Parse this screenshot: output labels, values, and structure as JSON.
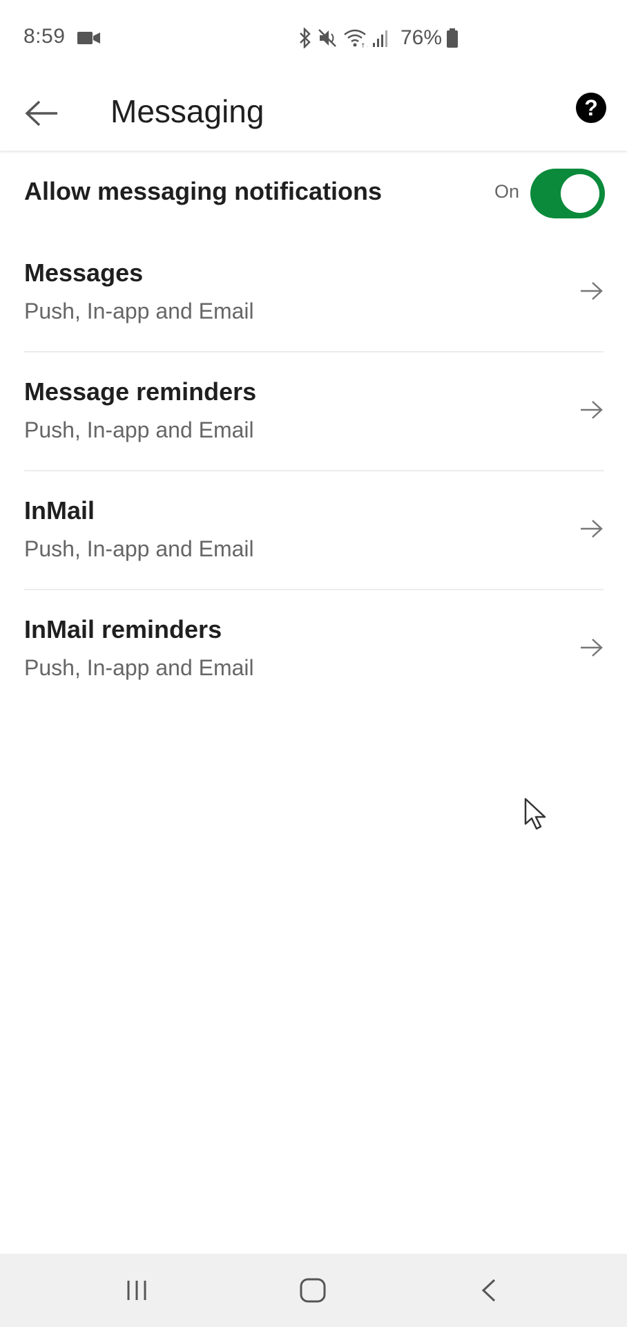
{
  "status_bar": {
    "time": "8:59",
    "battery": "76%",
    "icons": [
      "video-record-icon",
      "bluetooth-icon",
      "mute-icon",
      "wifi-icon",
      "signal-icon",
      "battery-icon"
    ]
  },
  "app_bar": {
    "title": "Messaging",
    "back_icon": "arrow-left-icon",
    "help_icon": "help-circle-icon",
    "help_glyph": "?"
  },
  "notifications_toggle": {
    "label": "Allow messaging notifications",
    "state_label": "On",
    "enabled": true,
    "accent_color": "#0a8a3a"
  },
  "settings": [
    {
      "title": "Messages",
      "subtitle": "Push, In-app and Email"
    },
    {
      "title": "Message reminders",
      "subtitle": "Push, In-app and Email"
    },
    {
      "title": "InMail",
      "subtitle": "Push, In-app and Email"
    },
    {
      "title": "InMail reminders",
      "subtitle": "Push, In-app and Email"
    }
  ],
  "nav_bar": {
    "icons": [
      "recent-apps-icon",
      "home-icon",
      "back-chevron-icon"
    ]
  }
}
